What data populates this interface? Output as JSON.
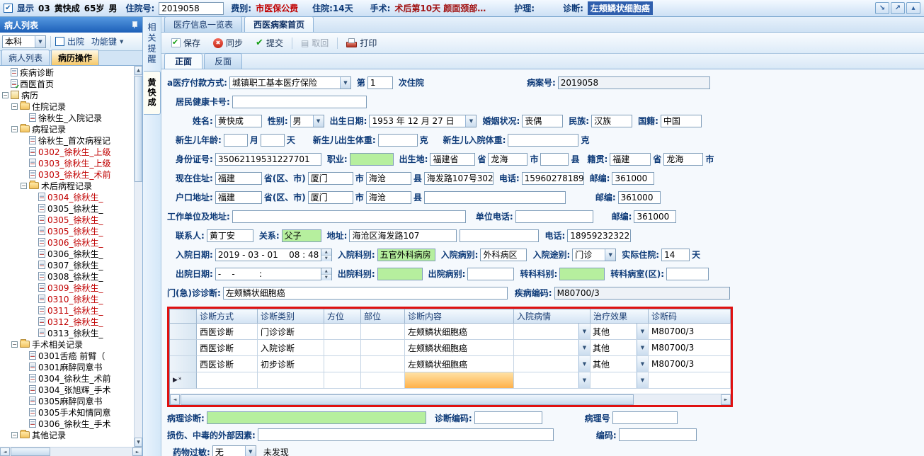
{
  "colors": {
    "accent_blue": "#1c5fb8",
    "field_green": "#b6ef9e",
    "annotation_red": "#e01010",
    "selection_blue": "#2f5fae",
    "alert_red": "#c00000",
    "new_row_orange": "#ffb14a"
  },
  "header": {
    "show_checkbox_label": "显示",
    "seq": "03",
    "patient_name": "黄快成",
    "age": "65岁",
    "sex": "男",
    "admission_no_label": "住院号:",
    "admission_no": "2019058",
    "fee_type_label": "费别:",
    "fee_type": "市医保公费",
    "stay": "住院:14天",
    "surgery_label": "手术:",
    "surgery_value": "术后第10天 颜面颈部…",
    "nursing_label": "护理:",
    "diagnosis_label": "诊断:",
    "diagnosis_value": "左颊鳞状细胞癌"
  },
  "left_panel": {
    "title": "病人列表",
    "dept_value": "本科",
    "discharge_label": "出院",
    "function_key_label": "功能键",
    "tabs": [
      {
        "label": "病人列表"
      },
      {
        "label": "病历操作"
      }
    ],
    "tree": [
      {
        "label": "疾病诊断",
        "level": 0,
        "icon": "doc"
      },
      {
        "label": "西医首页",
        "level": 0,
        "icon": "check"
      },
      {
        "label": "病历",
        "level": 0,
        "icon": "book",
        "expander": true
      },
      {
        "label": "住院记录",
        "level": 1,
        "icon": "folder",
        "expander": true
      },
      {
        "label": "徐秋生_入院记录",
        "level": 2,
        "icon": "doc"
      },
      {
        "label": "病程记录",
        "level": 1,
        "icon": "folder",
        "expander": true
      },
      {
        "label": "徐秋生_首次病程记",
        "level": 2,
        "icon": "doc"
      },
      {
        "label": "0302_徐秋生_上级",
        "level": 2,
        "icon": "doc",
        "color": "red"
      },
      {
        "label": "0303_徐秋生_上级",
        "level": 2,
        "icon": "doc",
        "color": "red"
      },
      {
        "label": "0303_徐秋生_术前",
        "level": 2,
        "icon": "doc",
        "color": "red"
      },
      {
        "label": "术后病程记录",
        "level": 2,
        "icon": "folder",
        "expander": true
      },
      {
        "label": "0304_徐秋生_",
        "level": 3,
        "icon": "doc",
        "color": "red"
      },
      {
        "label": "0305_徐秋生_",
        "level": 3,
        "icon": "doc"
      },
      {
        "label": "0305_徐秋生_",
        "level": 3,
        "icon": "doc",
        "color": "red"
      },
      {
        "label": "0305_徐秋生_",
        "level": 3,
        "icon": "doc",
        "color": "red"
      },
      {
        "label": "0306_徐秋生_",
        "level": 3,
        "icon": "doc",
        "color": "red"
      },
      {
        "label": "0306_徐秋生_",
        "level": 3,
        "icon": "doc"
      },
      {
        "label": "0307_徐秋生_",
        "level": 3,
        "icon": "doc"
      },
      {
        "label": "0308_徐秋生_",
        "level": 3,
        "icon": "doc"
      },
      {
        "label": "0309_徐秋生_",
        "level": 3,
        "icon": "doc",
        "color": "red"
      },
      {
        "label": "0310_徐秋生_",
        "level": 3,
        "icon": "doc",
        "color": "red"
      },
      {
        "label": "0311_徐秋生_",
        "level": 3,
        "icon": "doc",
        "color": "red"
      },
      {
        "label": "0312_徐秋生_",
        "level": 3,
        "icon": "doc",
        "color": "red"
      },
      {
        "label": "0313_徐秋生_",
        "level": 3,
        "icon": "doc"
      },
      {
        "label": "手术相关记录",
        "level": 1,
        "icon": "folder",
        "expander": true
      },
      {
        "label": "0301舌癌 前臂（",
        "level": 2,
        "icon": "doc"
      },
      {
        "label": "0301麻醉同意书",
        "level": 2,
        "icon": "doc"
      },
      {
        "label": "0304_徐秋生_术前",
        "level": 2,
        "icon": "doc"
      },
      {
        "label": "0304_张旭辉_手术",
        "level": 2,
        "icon": "doc"
      },
      {
        "label": "0305麻醉同意书",
        "level": 2,
        "icon": "doc"
      },
      {
        "label": "0305手术知情同意",
        "level": 2,
        "icon": "doc"
      },
      {
        "label": "0306_徐秋生_手术",
        "level": 2,
        "icon": "doc"
      },
      {
        "label": "其他记录",
        "level": 1,
        "icon": "folder",
        "expander": true
      }
    ]
  },
  "strips": {
    "related_reminder": "相关提醒",
    "patient_tab": "黄快成"
  },
  "main": {
    "tabs": [
      {
        "label": "医疗信息一览表"
      },
      {
        "label": "西医病案首页"
      }
    ],
    "toolbar": {
      "save": "保存",
      "sync": "同步",
      "submit": "提交",
      "retrieve": "取回",
      "print": "打印"
    },
    "subtabs": [
      {
        "label": "正面"
      },
      {
        "label": "反面"
      }
    ],
    "form": {
      "payment_label": "a医疗付款方式:",
      "payment_value": "城镇职工基本医疗保险",
      "nth_prefix": "第",
      "nth_value": "1",
      "nth_suffix": "次住院",
      "case_no_label": "病案号:",
      "case_no_value": "2019058",
      "health_card_label": "居民健康卡号:",
      "health_card_value": "",
      "name_label": "姓名:",
      "name_value": "黄快成",
      "sex_label": "性别:",
      "sex_value": "男",
      "birth_date_label": "出生日期:",
      "birth_date_value": "1953 年 12 月 27 日",
      "marital_label": "婚姻状况:",
      "marital_value": "丧偶",
      "ethnicity_label": "民族:",
      "ethnicity_value": "汉族",
      "nationality_label": "国籍:",
      "nationality_value": "中国",
      "newborn_age_label": "新生儿年龄:",
      "newborn_birth_weight_label": "新生儿出生体重:",
      "newborn_admit_weight_label": "新生儿入院体重:",
      "units": {
        "month": "月",
        "day": "天",
        "gram": "克",
        "province": "省",
        "city": "市",
        "county": "县",
        "province_area": "省(区、市)"
      },
      "id_card_label": "身份证号:",
      "id_card_value": "35062119531227701",
      "occupation_label": "职业:",
      "occupation_value": "",
      "birthplace_label": "出生地:",
      "birthplace_province": "福建省",
      "birthplace_city": "龙海",
      "birthplace_county": "",
      "native_label": "籍贯:",
      "native_province": "福建",
      "native_city": "龙海",
      "current_addr_label": "现在住址:",
      "current_province": "福建",
      "current_city": "厦门",
      "current_county": "海沧",
      "current_detail": "海发路107号302",
      "phone_label": "电话:",
      "phone_value": "15960278189",
      "zip_label": "邮编:",
      "zip1": "361000",
      "hukou_label": "户口地址:",
      "hukou_province": "福建",
      "hukou_city": "厦门",
      "hukou_county": "海沧",
      "hukou_detail": "",
      "zip2": "361000",
      "work_label": "工作单位及地址:",
      "work_value": "",
      "work_phone_label": "单位电话:",
      "work_phone_value": "",
      "zip3": "361000",
      "contact_label": "联系人:",
      "contact_value": "黄丁安",
      "relation_label": "关系:",
      "relation_value": "父子",
      "contact_addr_label": "地址:",
      "contact_addr_value": "海沧区海发路107",
      "contact_addr2_value": "",
      "contact_phone_value": "18959232322",
      "admit_date_label": "入院日期:",
      "admit_date_value": "2019 - 03 - 01    08 : 48",
      "admit_dept_label": "入院科别:",
      "admit_dept_value": "五官外科病房",
      "admit_ward_label": "入院病别:",
      "admit_ward_value": "外科病区",
      "admit_route_label": "入院途别:",
      "admit_route_value": "门诊",
      "actual_stay_label": "实际住院:",
      "actual_stay_value": "14",
      "discharge_date_label": "出院日期:",
      "discharge_date_value": "-    -         :",
      "discharge_dept_label": "出院科别:",
      "discharge_dept_value": "",
      "discharge_ward_label": "出院病别:",
      "discharge_ward_value": "",
      "transfer_dept_label": "转科科别:",
      "transfer_dept_value": "",
      "transfer_ward_label": "转科病室(区):",
      "transfer_ward_value": "",
      "outpatient_diag_label": "门(急)诊诊断:",
      "outpatient_diag_value": "左颊鳞状细胞癌",
      "disease_code_label": "疾病编码:",
      "disease_code_value": "M80700/3"
    },
    "diagnosis_table": {
      "headers": [
        "诊断方式",
        "诊断类别",
        "方位",
        "部位",
        "诊断内容",
        "入院病情",
        "治疗效果",
        "诊断码"
      ],
      "rows": [
        {
          "method": "西医诊断",
          "category": "门诊诊断",
          "direction": "",
          "part": "",
          "content": "左颊鳞状细胞癌",
          "admission_condition": "",
          "treatment_effect": "其他",
          "code": "M80700/3"
        },
        {
          "method": "西医诊断",
          "category": "入院诊断",
          "direction": "",
          "part": "",
          "content": "左颊鳞状细胞癌",
          "admission_condition": "",
          "treatment_effect": "其他",
          "code": "M80700/3"
        },
        {
          "method": "西医诊断",
          "category": "初步诊断",
          "direction": "",
          "part": "",
          "content": "左颊鳞状细胞癌",
          "admission_condition": "",
          "treatment_effect": "其他",
          "code": "M80700/3"
        }
      ],
      "new_row_marker": "▶*"
    },
    "bottom": {
      "pathology_diag_label": "病理诊断:",
      "pathology_diag_value": "",
      "diag_code_label": "诊断编码:",
      "diag_code_value": "",
      "pathology_no_label": "病理号",
      "pathology_no_value": "",
      "injury_label": "损伤、中毒的外部因素:",
      "injury_value": "",
      "code_label": "编码:",
      "code_value": "",
      "allergy_label": "药物过敏:",
      "allergy_value": "无",
      "allergy_note": "未发现"
    }
  }
}
